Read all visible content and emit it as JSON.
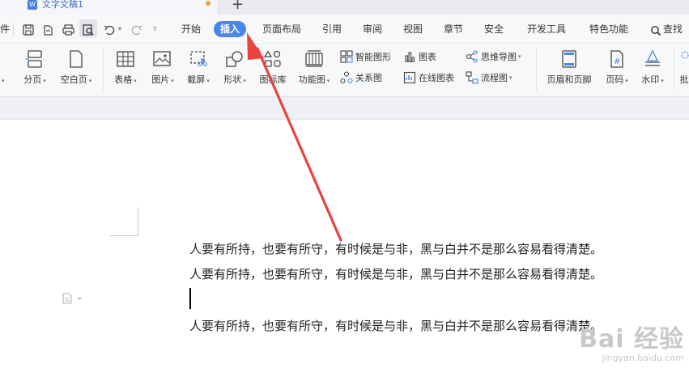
{
  "tab": {
    "title": "文字文稿1",
    "new_tab": "+"
  },
  "menu": {
    "file_partial": "件",
    "items": [
      "开始",
      "插入",
      "页面布局",
      "引用",
      "审阅",
      "视图",
      "章节",
      "安全",
      "开发工具",
      "特色功能"
    ],
    "active": "插入",
    "search": "查找"
  },
  "ribbon": {
    "page_break": "分页",
    "blank_page": "空白页",
    "table": "表格",
    "picture": "图片",
    "screenshot": "截屏",
    "shape": "形状",
    "icon_library": "图标库",
    "feature_chart": "功能图",
    "smart_shape": "智能图形",
    "chart": "图表",
    "mind_map": "思维导图",
    "relation_chart": "关系图",
    "online_chart": "在线图表",
    "flowchart": "流程图",
    "header_footer": "页眉和页脚",
    "page_number": "页码",
    "watermark": "水印",
    "partial_label": "批"
  },
  "document": {
    "lines": [
      "人要有所持，也要有所守，有时候是与非，黑与白并不是那么容易看得清楚。",
      "人要有所持，也要有所守，有时候是与非，黑与白并不是那么容易看得清楚。",
      "",
      "人要有所持，也要有所守，有时候是与非，黑与白并不是那么容易看得清楚。"
    ]
  },
  "watermark": {
    "logo": "Bai 经验",
    "url": "jingyan.baidu.com"
  },
  "colors": {
    "accent": "#4a86e8",
    "arrow": "#e8433c"
  }
}
